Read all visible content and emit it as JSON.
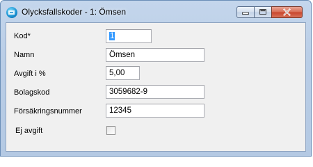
{
  "window": {
    "title": "Olycksfallskoder - 1: Ömsen",
    "icon": "app-icon",
    "controls": [
      "minimize-icon",
      "maximize-icon",
      "close-icon"
    ]
  },
  "form": {
    "kod": {
      "label": "Kod*",
      "value": "1"
    },
    "namn": {
      "label": "Namn",
      "value": "Ömsen"
    },
    "avgift": {
      "label": "Avgift i %",
      "value": "5,00"
    },
    "bolagskod": {
      "label": "Bolagskod",
      "value": "3059682-9"
    },
    "forsakringsnummer": {
      "label": "Försäkringsnummer",
      "value": "12345"
    },
    "ej_avgift": {
      "label": "Ej avgift",
      "checked": false
    }
  },
  "colors": {
    "frame": "#b9cde6",
    "client": "#f0f0f0",
    "selection": "#3399ff",
    "close_button": "#c7442b"
  }
}
